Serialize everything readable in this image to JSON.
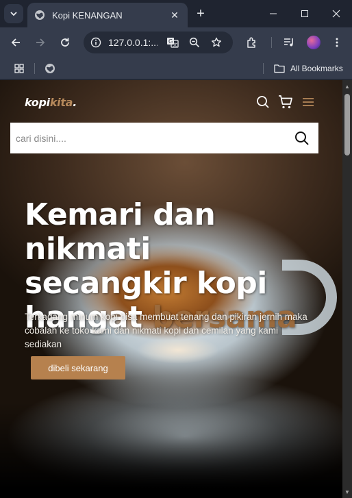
{
  "browser": {
    "tab_title": "Kopi KENANGAN",
    "url": "127.0.0.1:...",
    "bookmarks_label": "All Bookmarks"
  },
  "site": {
    "brand_part1": "kopi",
    "brand_part2": "kita",
    "brand_dot": ".",
    "search_placeholder": "cari disini....",
    "hero_line1": "Kemari dan nikmati",
    "hero_line2": "secangkir kopi",
    "hero_line3_plain": "hangat ",
    "hero_line3_accent": "bersama",
    "hero_desc": "Terkadang minum kopi bisa membuat tenang dan pikiran jernih maka cobalah ke toko kami dan nikmati kopi dan cemilan yang kami sediakan",
    "cta_label": "dibeli sekarang"
  },
  "colors": {
    "brand_accent": "#b6895b",
    "cta_bg": "#b6814e",
    "hero_accent": "#9b6a3c"
  }
}
